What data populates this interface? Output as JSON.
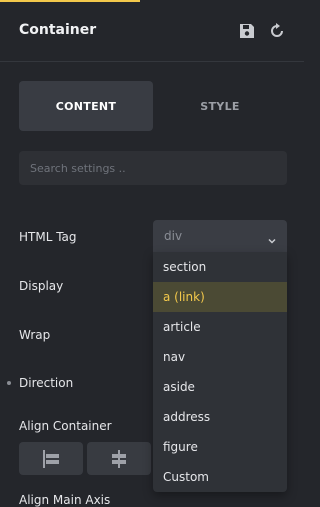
{
  "header": {
    "title": "Container",
    "icons": [
      "save-icon",
      "refresh-icon"
    ]
  },
  "tabs": [
    {
      "label": "CONTENT",
      "active": true
    },
    {
      "label": "STYLE",
      "active": false
    }
  ],
  "search": {
    "placeholder": "Search settings ..",
    "value": ""
  },
  "settings": {
    "html_tag": {
      "label": "HTML Tag",
      "value": "div"
    },
    "display": {
      "label": "Display"
    },
    "wrap": {
      "label": "Wrap"
    },
    "direction": {
      "label": "Direction"
    },
    "align_container": {
      "label": "Align Container"
    },
    "align_main_axis": {
      "label": "Align Main Axis"
    }
  },
  "dropdown": {
    "options": [
      "section",
      "a (link)",
      "article",
      "nav",
      "aside",
      "address",
      "figure",
      "Custom"
    ],
    "highlighted": "a (link)"
  },
  "colors": {
    "accent": "#f2c84b",
    "background": "#24262b",
    "panel": "#393c43"
  }
}
